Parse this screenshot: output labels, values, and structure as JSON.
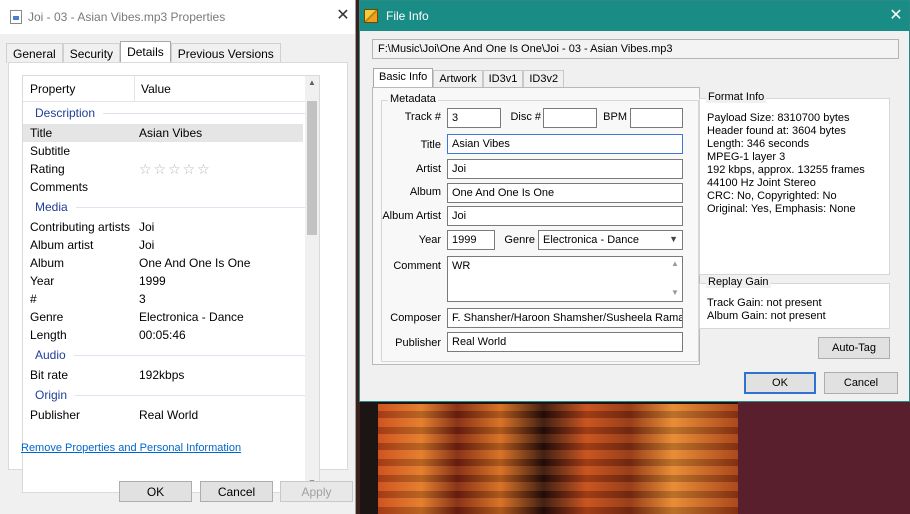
{
  "properties_window": {
    "title": "Joi - 03 - Asian Vibes.mp3 Properties",
    "tabs": [
      "General",
      "Security",
      "Details",
      "Previous Versions"
    ],
    "active_tab": "Details",
    "columns": {
      "property": "Property",
      "value": "Value"
    },
    "sections": [
      {
        "title": "Description",
        "rows": [
          {
            "key": "Title",
            "value": "Asian Vibes"
          },
          {
            "key": "Subtitle",
            "value": ""
          },
          {
            "key": "Rating",
            "value": ""
          },
          {
            "key": "Comments",
            "value": ""
          }
        ]
      },
      {
        "title": "Media",
        "rows": [
          {
            "key": "Contributing artists",
            "value": "Joi"
          },
          {
            "key": "Album artist",
            "value": "Joi"
          },
          {
            "key": "Album",
            "value": "One And One Is One"
          },
          {
            "key": "Year",
            "value": "1999"
          },
          {
            "key": "#",
            "value": "3"
          },
          {
            "key": "Genre",
            "value": "Electronica - Dance"
          },
          {
            "key": "Length",
            "value": "00:05:46"
          }
        ]
      },
      {
        "title": "Audio",
        "rows": [
          {
            "key": "Bit rate",
            "value": "192kbps"
          }
        ]
      },
      {
        "title": "Origin",
        "rows": [
          {
            "key": "Publisher",
            "value": "Real World"
          }
        ]
      }
    ],
    "rating_stars": "☆☆☆☆☆",
    "remove_link": "Remove Properties and Personal Information",
    "buttons": {
      "ok": "OK",
      "cancel": "Cancel",
      "apply": "Apply"
    }
  },
  "file_info_window": {
    "title": "File Info",
    "path": "F:\\Music\\Joi\\One And One Is One\\Joi - 03 - Asian Vibes.mp3",
    "tabs": [
      "Basic Info",
      "Artwork",
      "ID3v1",
      "ID3v2"
    ],
    "active_tab": "Basic Info",
    "metadata": {
      "legend": "Metadata",
      "track_label": "Track #",
      "track": "3",
      "disc_label": "Disc #",
      "disc": "",
      "bpm_label": "BPM",
      "bpm": "",
      "title_label": "Title",
      "title": "Asian Vibes",
      "artist_label": "Artist",
      "artist": "Joi",
      "album_label": "Album",
      "album": "One And One Is One",
      "album_artist_label": "Album Artist",
      "album_artist": "Joi",
      "year_label": "Year",
      "year": "1999",
      "genre_label": "Genre",
      "genre": "Electronica - Dance",
      "comment_label": "Comment",
      "comment": "WR",
      "composer_label": "Composer",
      "composer": "F. Shansher/Haroon Shamsher/Susheela Ramar",
      "publisher_label": "Publisher",
      "publisher": "Real World"
    },
    "format_info": {
      "legend": "Format Info",
      "lines": [
        "Payload Size: 8310700 bytes",
        "Header found at: 3604 bytes",
        "Length: 346 seconds",
        "MPEG-1 layer 3",
        "192 kbps, approx. 13255 frames",
        "44100 Hz Joint Stereo",
        "CRC: No, Copyrighted: No",
        "Original: Yes, Emphasis: None"
      ]
    },
    "replay_gain": {
      "legend": "Replay Gain",
      "track_gain": "Track Gain: not present",
      "album_gain": "Album Gain: not present"
    },
    "buttons": {
      "auto_tag": "Auto-Tag",
      "ok": "OK",
      "cancel": "Cancel"
    }
  }
}
